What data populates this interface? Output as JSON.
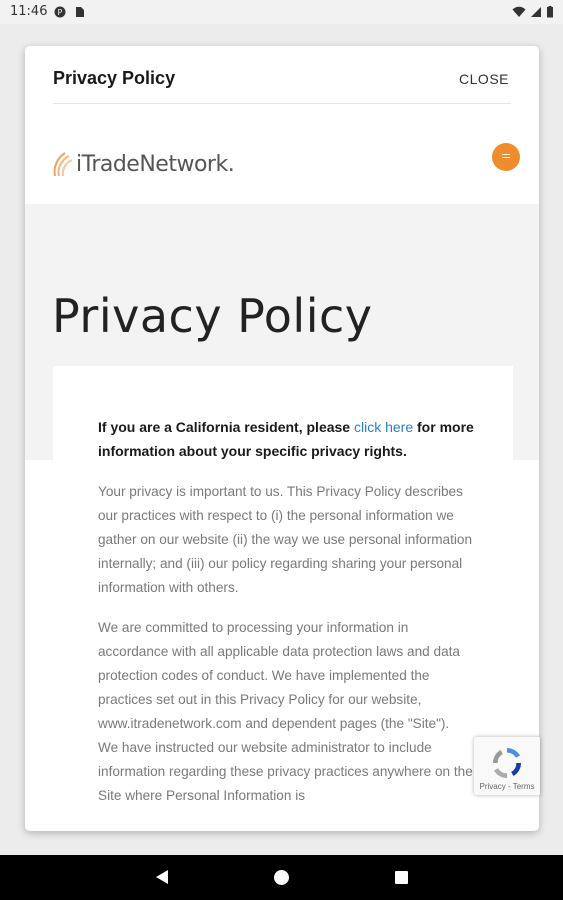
{
  "status_bar": {
    "time": "11:46"
  },
  "modal": {
    "title": "Privacy Policy",
    "close_label": "CLOSE"
  },
  "site": {
    "logo_text": "iTradeNetwork.",
    "hero_title": "Privacy Policy"
  },
  "content": {
    "ca_notice_before": "If you are a California resident, please ",
    "ca_notice_link": "click here",
    "ca_notice_after": " for more information about your specific privacy rights.",
    "paragraph_1": "Your privacy is important to us. This Privacy Policy describes our practices with respect to (i) the personal information we gather on our website (ii) the way we use personal information internally; and (iii) our policy regarding sharing your personal information with others.",
    "paragraph_2": "We are committed to processing your information in accordance with all applicable data protection laws and data protection codes of conduct.  We have implemented the practices set out in this Privacy Policy for our website, www.itradenetwork.com and dependent pages (the \"Site\"). We have instructed our website administrator to include information regarding these privacy practices anywhere on the Site where Personal Information is"
  },
  "recaptcha": {
    "footer": "Privacy - Terms"
  },
  "colors": {
    "accent_orange": "#ef8c2c",
    "link_blue": "#2a7fc9"
  }
}
